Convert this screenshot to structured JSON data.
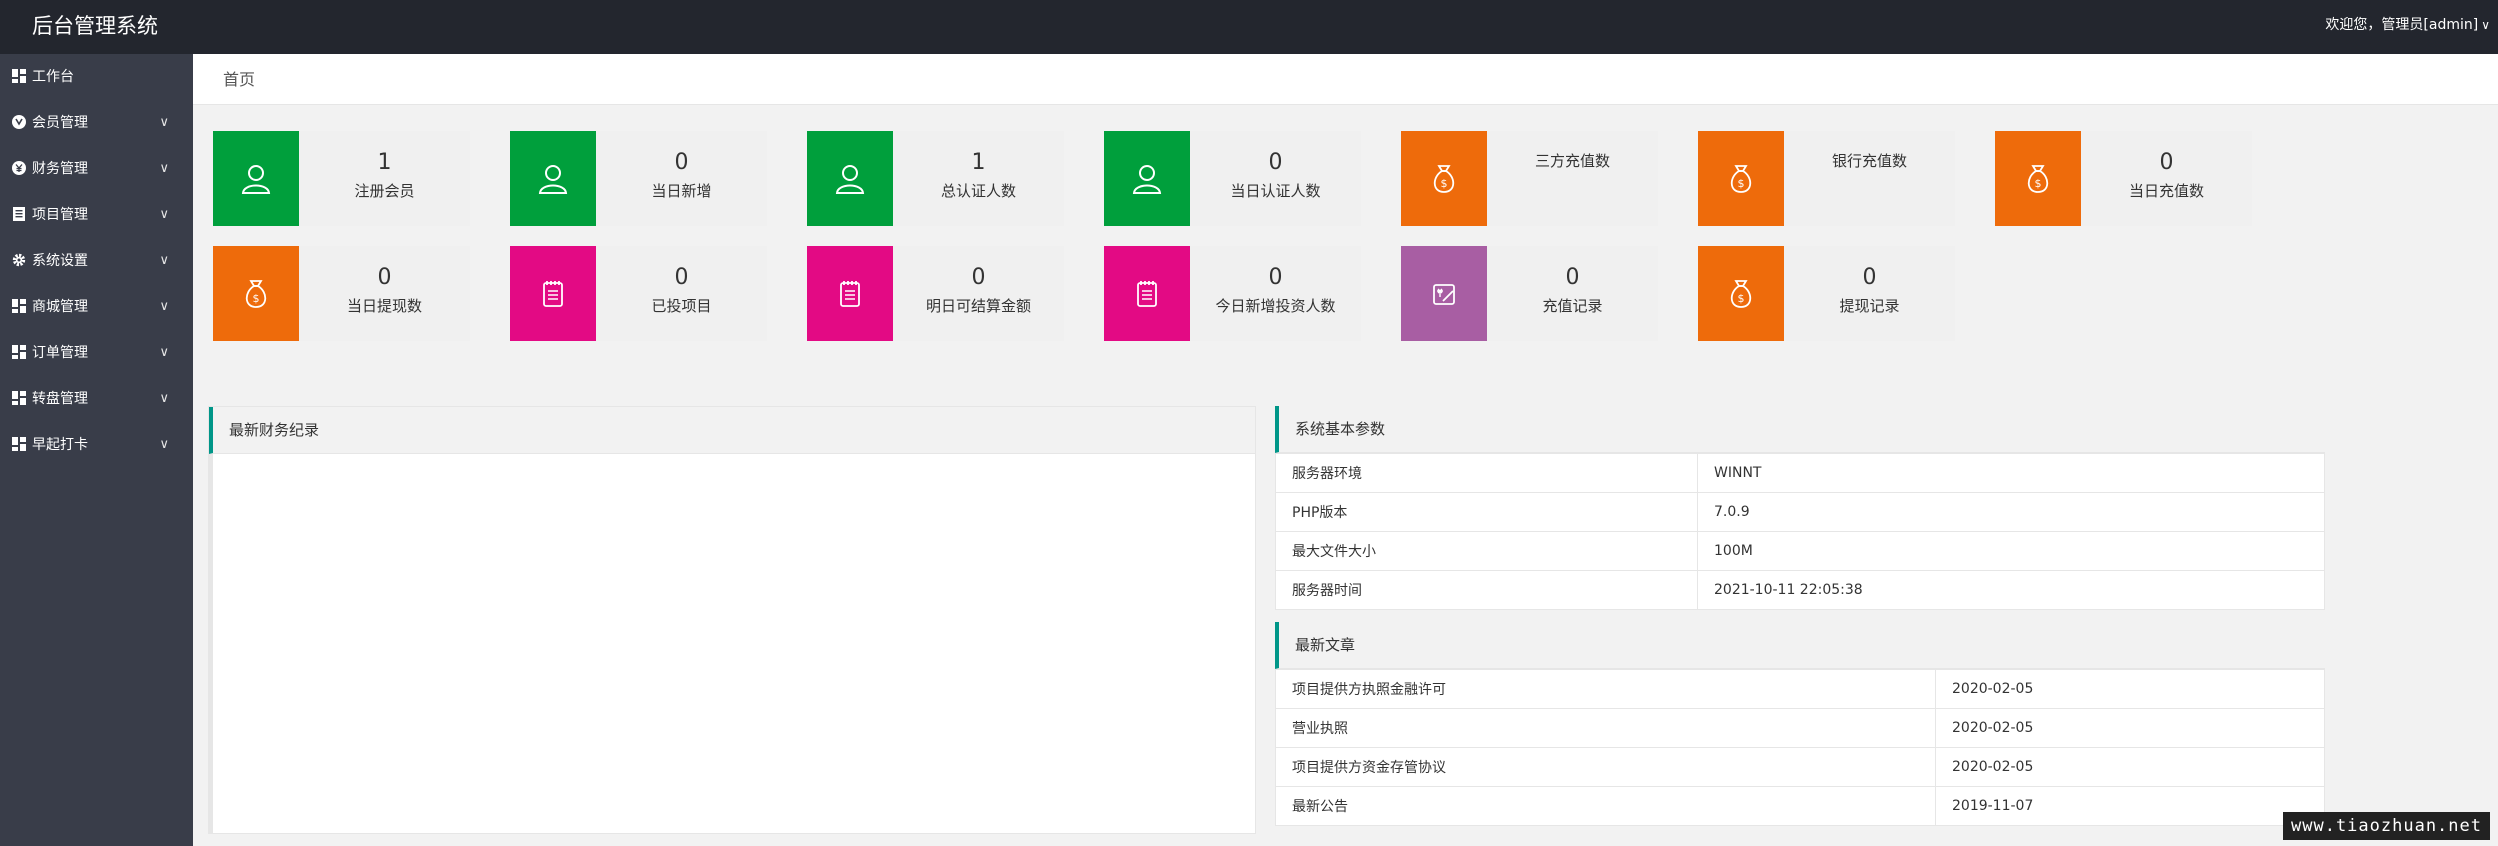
{
  "header": {
    "title": "后台管理系统",
    "user_text": "欢迎您，管理员[admin]",
    "caret": "∨"
  },
  "sidebar": {
    "items": [
      {
        "label": "工作台",
        "icon": "dashboard-icon",
        "has_arrow": false
      },
      {
        "label": "会员管理",
        "icon": "member-icon",
        "has_arrow": true
      },
      {
        "label": "财务管理",
        "icon": "finance-icon",
        "has_arrow": true
      },
      {
        "label": "项目管理",
        "icon": "project-icon",
        "has_arrow": true
      },
      {
        "label": "系统设置",
        "icon": "gear-icon",
        "has_arrow": true
      },
      {
        "label": "商城管理",
        "icon": "shop-icon",
        "has_arrow": true
      },
      {
        "label": "订单管理",
        "icon": "order-icon",
        "has_arrow": true
      },
      {
        "label": "转盘管理",
        "icon": "wheel-icon",
        "has_arrow": true
      },
      {
        "label": "早起打卡",
        "icon": "checkin-icon",
        "has_arrow": true
      }
    ],
    "arrow": "∨"
  },
  "breadcrumb": "首页",
  "colors": {
    "green": "#009f3c",
    "orange": "#ee6b0b",
    "magenta": "#e30a84",
    "purple": "#a85ea3"
  },
  "stats": [
    {
      "value": "1",
      "label": "注册会员",
      "color": "#009f3c",
      "icon": "user-icon"
    },
    {
      "value": "0",
      "label": "当日新增",
      "color": "#009f3c",
      "icon": "user-icon"
    },
    {
      "value": "1",
      "label": "总认证人数",
      "color": "#009f3c",
      "icon": "user-icon"
    },
    {
      "value": "0",
      "label": "当日认证人数",
      "color": "#009f3c",
      "icon": "user-icon"
    },
    {
      "value": "",
      "label": "三方充值数",
      "color": "#ee6b0b",
      "icon": "money-bag-icon"
    },
    {
      "value": "",
      "label": "银行充值数",
      "color": "#ee6b0b",
      "icon": "money-bag-icon"
    },
    {
      "value": "0",
      "label": "当日充值数",
      "color": "#ee6b0b",
      "icon": "money-bag-icon"
    },
    {
      "value": "0",
      "label": "当日提现数",
      "color": "#ee6b0b",
      "icon": "money-bag-icon"
    },
    {
      "value": "0",
      "label": "已投项目",
      "color": "#e30a84",
      "icon": "notepad-icon"
    },
    {
      "value": "0",
      "label": "明日可结算金额",
      "color": "#e30a84",
      "icon": "notepad-icon"
    },
    {
      "value": "0",
      "label": "今日新增投资人数",
      "color": "#e30a84",
      "icon": "notepad-icon"
    },
    {
      "value": "0",
      "label": "充值记录",
      "color": "#a85ea3",
      "icon": "recharge-card-icon"
    },
    {
      "value": "0",
      "label": "提现记录",
      "color": "#ee6b0b",
      "icon": "money-bag-icon"
    }
  ],
  "finance_panel": {
    "title": "最新财务纪录"
  },
  "sys_panel": {
    "title": "系统基本参数",
    "rows": [
      {
        "key": "服务器环境",
        "value": "WINNT"
      },
      {
        "key": "PHP版本",
        "value": "7.0.9"
      },
      {
        "key": "最大文件大小",
        "value": "100M"
      },
      {
        "key": "服务器时间",
        "value": "2021-10-11 22:05:38"
      }
    ]
  },
  "article_panel": {
    "title": "最新文章",
    "rows": [
      {
        "title": "项目提供方执照金融许可",
        "date": "2020-02-05"
      },
      {
        "title": "营业执照",
        "date": "2020-02-05"
      },
      {
        "title": "项目提供方资金存管协议",
        "date": "2020-02-05"
      },
      {
        "title": "最新公告",
        "date": "2019-11-07"
      }
    ]
  },
  "watermark": "www.tiaozhuan.net"
}
